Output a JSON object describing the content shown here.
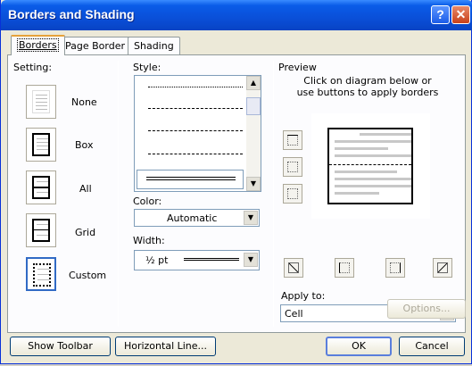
{
  "window": {
    "title": "Borders and Shading"
  },
  "titlebar": {
    "help_label": "?",
    "close_label": "✕"
  },
  "tabs": [
    {
      "label": "Borders"
    },
    {
      "label": "Page Border"
    },
    {
      "label": "Shading"
    }
  ],
  "setting": {
    "label": "Setting:",
    "options": [
      {
        "label": "None",
        "icon": "none-setting-icon"
      },
      {
        "label": "Box",
        "icon": "box-setting-icon"
      },
      {
        "label": "All",
        "icon": "all-setting-icon"
      },
      {
        "label": "Grid",
        "icon": "grid-setting-icon"
      },
      {
        "label": "Custom",
        "icon": "custom-setting-icon",
        "selected": true
      }
    ]
  },
  "style": {
    "label": "Style:",
    "items": [
      "dotted",
      "dashed",
      "dash-dot",
      "dash-dot-dot",
      "double"
    ],
    "selected_index": 4
  },
  "color": {
    "label": "Color:",
    "value": "Automatic"
  },
  "width": {
    "label": "Width:",
    "value": "½ pt"
  },
  "preview": {
    "label": "Preview",
    "instructions": "Click on diagram below or use buttons to apply borders"
  },
  "apply_to": {
    "label": "Apply to:",
    "value": "Cell"
  },
  "buttons": {
    "options": "Options...",
    "show_toolbar": "Show Toolbar",
    "horizontal_line": "Horizontal Line...",
    "ok": "OK",
    "cancel": "Cancel"
  },
  "colors": {
    "title_bar": "#0a4fd8",
    "dialog_bg": "#ece9d8",
    "tab_accent": "#e6a23a"
  }
}
